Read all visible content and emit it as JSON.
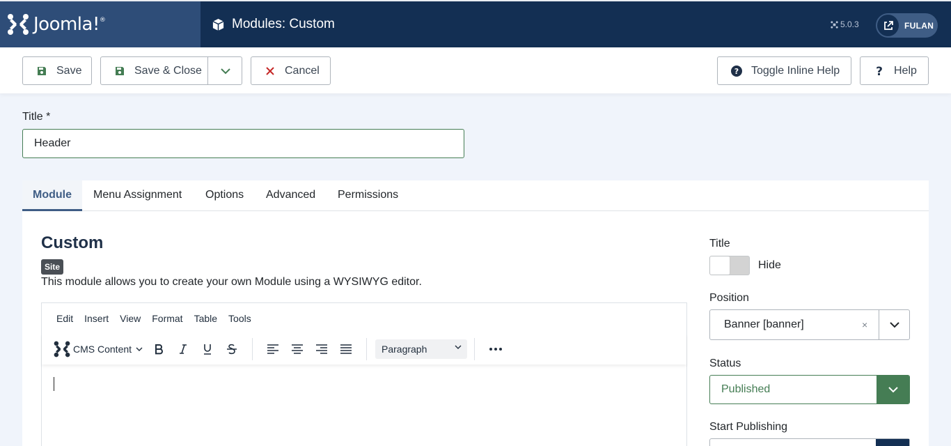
{
  "header": {
    "logo_text": "Joomla!",
    "logo_reg": "®",
    "page_title": "Modules: Custom",
    "version": "5.0.3",
    "user": "FULAN"
  },
  "toolbar": {
    "save_label": "Save",
    "save_close_label": "Save & Close",
    "cancel_label": "Cancel",
    "inline_help_label": "Toggle Inline Help",
    "help_label": "Help"
  },
  "title_field": {
    "label": "Title *",
    "value": "Header"
  },
  "tabs": [
    {
      "label": "Module",
      "active": true
    },
    {
      "label": "Menu Assignment",
      "active": false
    },
    {
      "label": "Options",
      "active": false
    },
    {
      "label": "Advanced",
      "active": false
    },
    {
      "label": "Permissions",
      "active": false
    }
  ],
  "module": {
    "heading": "Custom",
    "badge": "Site",
    "description": "This module allows you to create your own Module using a WYSIWYG editor."
  },
  "editor": {
    "menu": [
      "Edit",
      "Insert",
      "View",
      "Format",
      "Table",
      "Tools"
    ],
    "cms_content_label": "CMS Content",
    "block_format": "Paragraph",
    "icons": [
      "bold-icon",
      "italic-icon",
      "underline-icon",
      "strikethrough-icon",
      "align-left-icon",
      "align-center-icon",
      "align-right-icon",
      "align-justify-icon",
      "more-icon"
    ]
  },
  "sidebar": {
    "title_label": "Title",
    "title_toggle_text": "Hide",
    "position_label": "Position",
    "position_value": "Banner [banner]",
    "position_clear": "×",
    "status_label": "Status",
    "status_value": "Published",
    "start_publishing_label": "Start Publishing"
  },
  "colors": {
    "header_bg": "#132f53",
    "logo_bg": "#2e4d78",
    "accent": "#3f5d85",
    "success": "#457d54",
    "cancel_red": "#c52827"
  }
}
